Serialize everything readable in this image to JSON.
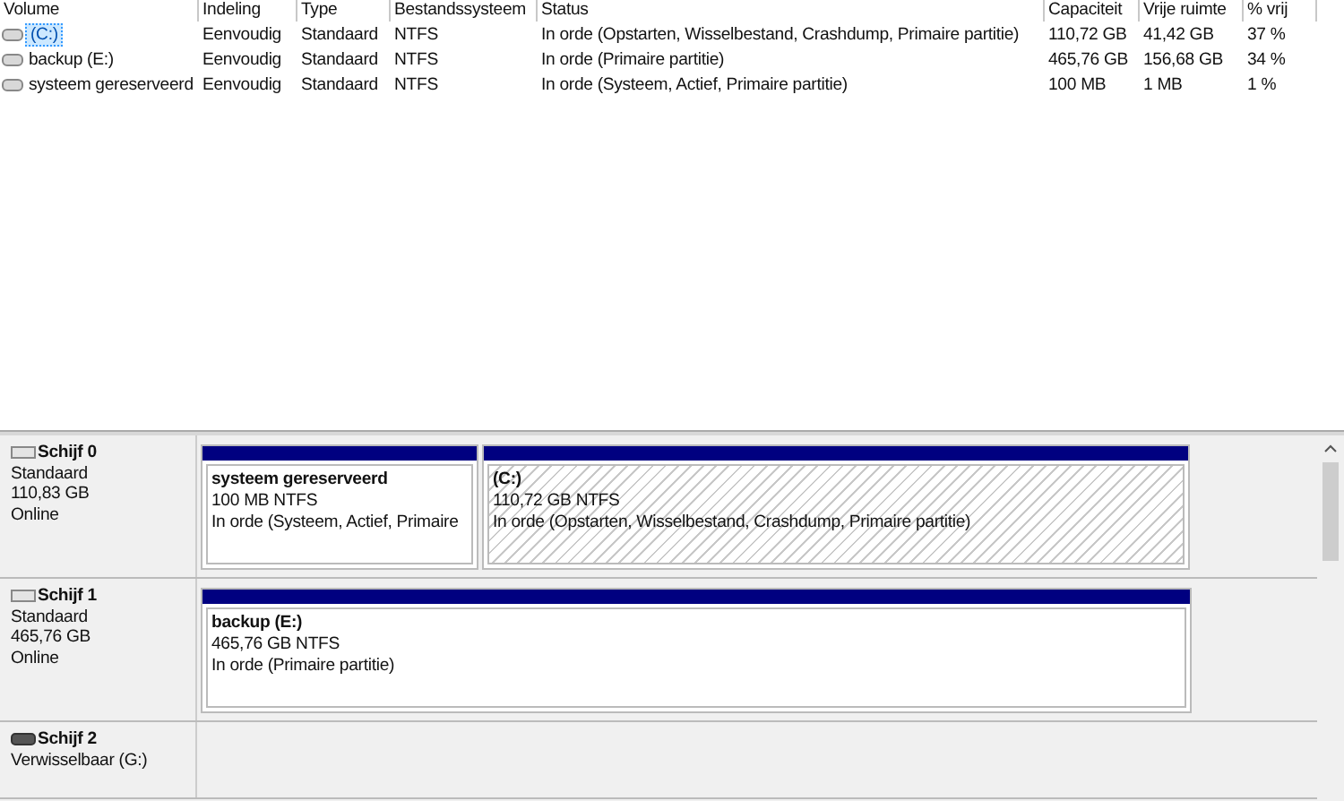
{
  "volumes": {
    "columns": [
      "Volume",
      "Indeling",
      "Type",
      "Bestandssysteem",
      "Status",
      "Capaciteit",
      "Vrije ruimte",
      "% vrij"
    ],
    "rows": [
      {
        "cells": [
          "(C:)",
          "Eenvoudig",
          "Standaard",
          "NTFS",
          "In orde (Opstarten, Wisselbestand, Crashdump, Primaire partitie)",
          "110,72 GB",
          "41,42 GB",
          "37 %"
        ],
        "selected": true
      },
      {
        "cells": [
          "backup (E:)",
          "Eenvoudig",
          "Standaard",
          "NTFS",
          "In orde (Primaire partitie)",
          "465,76 GB",
          "156,68 GB",
          "34 %"
        ],
        "selected": false
      },
      {
        "cells": [
          "systeem gereserveerd",
          "Eenvoudig",
          "Standaard",
          "NTFS",
          "In orde (Systeem, Actief, Primaire partitie)",
          "100 MB",
          "1 MB",
          "1 %"
        ],
        "selected": false
      }
    ]
  },
  "disks": [
    {
      "kind": "fixed",
      "name": "Schijf 0",
      "details": [
        "Standaard",
        "110,83 GB",
        "Online"
      ],
      "partitions": [
        {
          "name": "systeem gereserveerd",
          "size": "100 MB NTFS",
          "status": "In orde (Systeem, Actief, Primaire",
          "selected": false
        },
        {
          "name": "(C:)",
          "size": "110,72 GB NTFS",
          "status": "In orde (Opstarten, Wisselbestand, Crashdump, Primaire partitie)",
          "selected": true
        }
      ]
    },
    {
      "kind": "fixed",
      "name": "Schijf 1",
      "details": [
        "Standaard",
        "465,76 GB",
        "Online"
      ],
      "partitions": [
        {
          "name": "backup  (E:)",
          "size": "465,76 GB NTFS",
          "status": "In orde (Primaire partitie)",
          "selected": false
        }
      ]
    },
    {
      "kind": "removable",
      "name": "Schijf 2",
      "details": [
        "Verwisselbaar (G:)"
      ]
    }
  ]
}
